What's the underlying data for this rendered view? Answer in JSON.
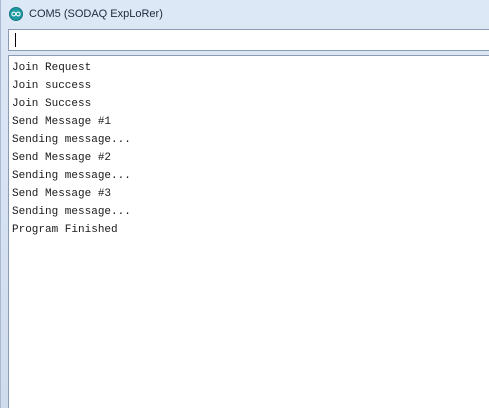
{
  "window": {
    "title": "COM5 (SODAQ ExpLoRer)",
    "icon": "arduino-icon"
  },
  "input": {
    "value": ""
  },
  "output": {
    "lines": [
      "Join Request",
      "Join success",
      "Join Success",
      "Send Message #1",
      "Sending message...",
      "Send Message #2",
      "Sending message...",
      "Send Message #3",
      "Sending message...",
      "Program Finished"
    ]
  },
  "colors": {
    "titlebar": "#d6e3f3",
    "icon": "#1f9aa2"
  }
}
